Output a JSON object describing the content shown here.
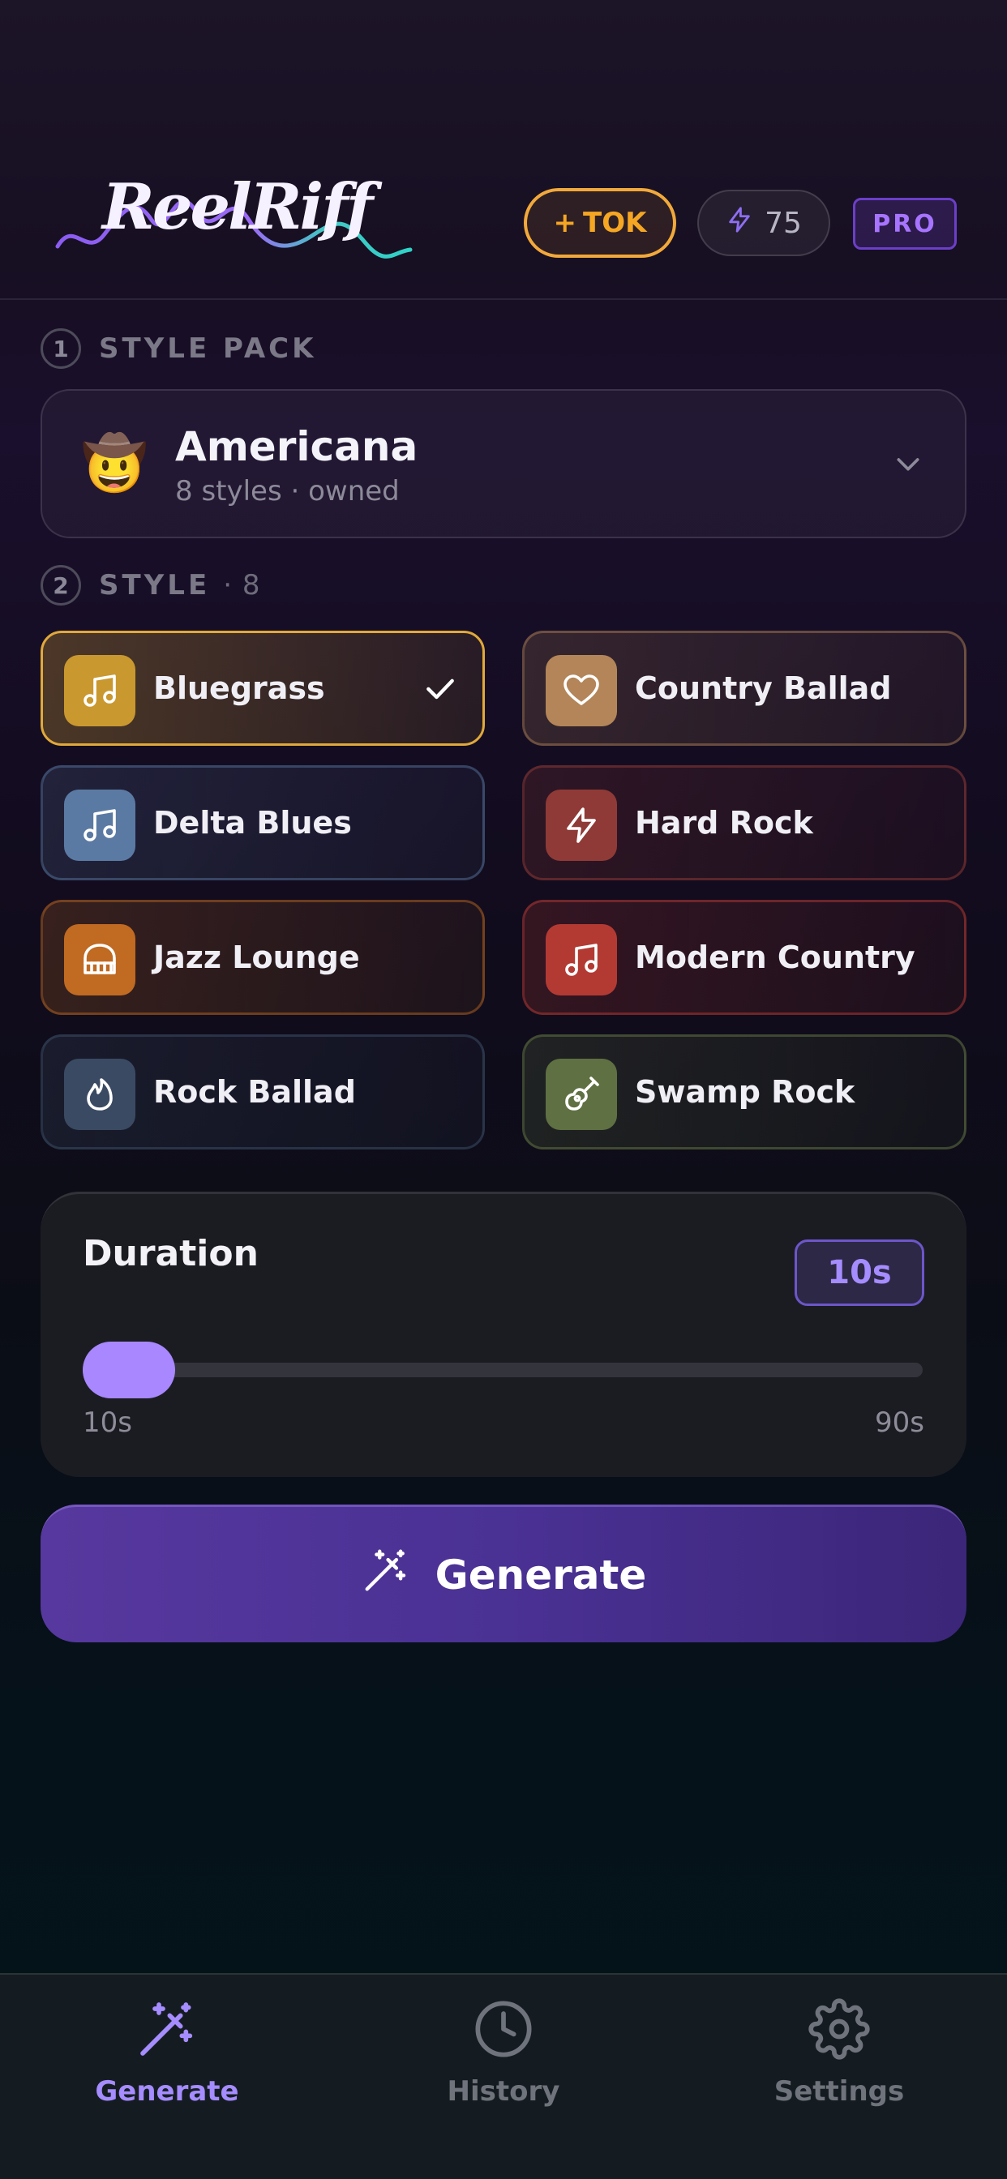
{
  "header": {
    "logo_text": "ReelRiff",
    "tok_button_plus": "+",
    "tok_button_label": "TOK",
    "credits": "75",
    "pro_badge": "PRO"
  },
  "style_pack": {
    "step": "1",
    "label": "STYLE PACK",
    "selected_emoji": "🤠",
    "selected_name": "Americana",
    "selected_sub": "8 styles · owned",
    "chevron_icon": "chevron-down-icon"
  },
  "style": {
    "step": "2",
    "label": "STYLE",
    "count": "· 8",
    "items": [
      {
        "label": "Bluegrass",
        "icon": "music-note-icon",
        "color": "#c9982f",
        "selected": true
      },
      {
        "label": "Country Ballad",
        "icon": "heart-icon",
        "color": "#b38558",
        "selected": false
      },
      {
        "label": "Delta Blues",
        "icon": "music-note-icon",
        "color": "#5b7aa3",
        "selected": false
      },
      {
        "label": "Hard Rock",
        "icon": "lightning-icon",
        "color": "#8f3a36",
        "selected": false
      },
      {
        "label": "Jazz Lounge",
        "icon": "piano-icon",
        "color": "#c06a22",
        "selected": false
      },
      {
        "label": "Modern Country",
        "icon": "music-note-icon",
        "color": "#b33a33",
        "selected": false
      },
      {
        "label": "Rock Ballad",
        "icon": "flame-icon",
        "color": "#3b4a63",
        "selected": false
      },
      {
        "label": "Swamp Rock",
        "icon": "guitar-icon",
        "color": "#5f7042",
        "selected": false
      }
    ]
  },
  "duration": {
    "title": "Duration",
    "value": "10s",
    "min_label": "10s",
    "max_label": "90s",
    "min": 10,
    "max": 90,
    "current": 10
  },
  "generate_button": {
    "label": "Generate",
    "icon": "magic-wand-icon"
  },
  "tabbar": {
    "items": [
      {
        "label": "Generate",
        "icon": "magic-wand-icon",
        "active": true
      },
      {
        "label": "History",
        "icon": "clock-icon",
        "active": false
      },
      {
        "label": "Settings",
        "icon": "gear-icon",
        "active": false
      }
    ]
  },
  "colors": {
    "accent": "#a58cff",
    "tok": "#f5a623",
    "pro": "#a774ff",
    "selected_border": "#e0a93a"
  }
}
